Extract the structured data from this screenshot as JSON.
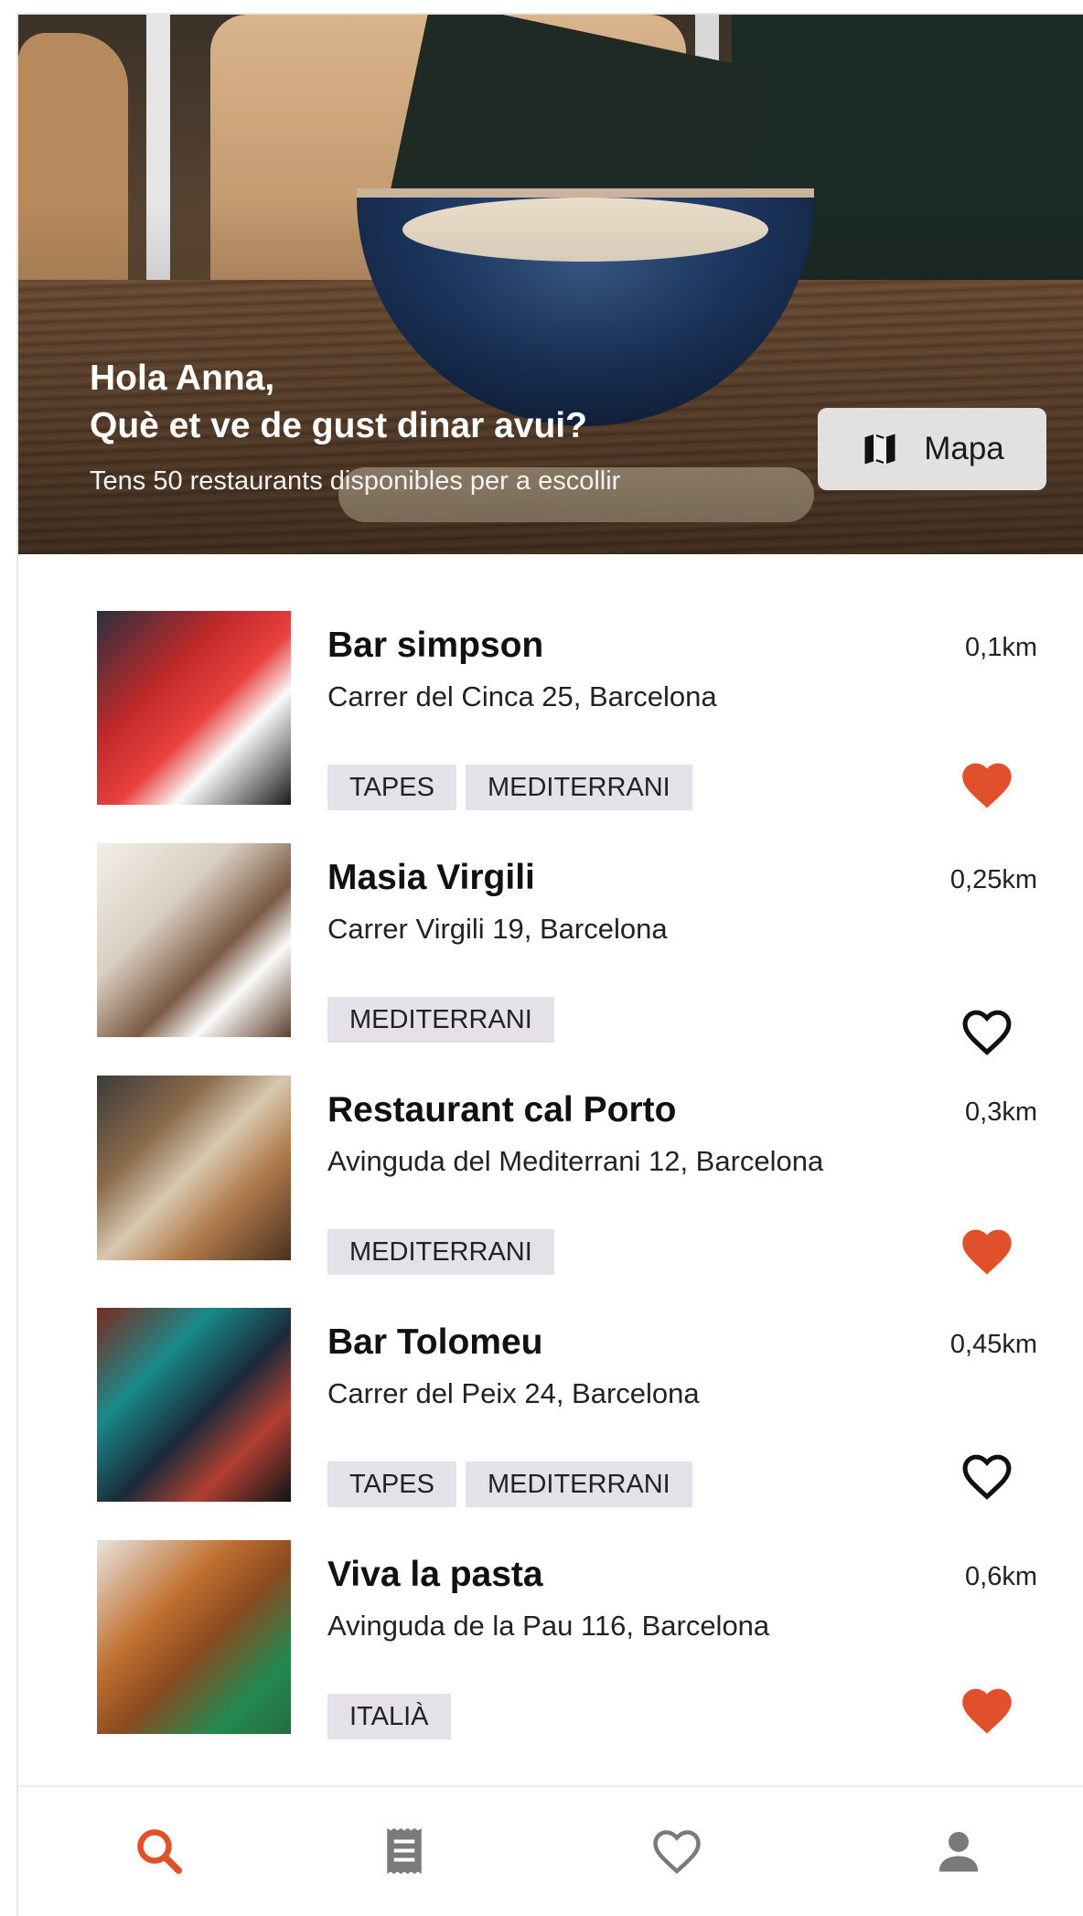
{
  "hero": {
    "greeting_line1": "Hola Anna,",
    "greeting_line2": "Què et ve de gust dinar avui?",
    "subtitle": "Tens 50 restaurants disponibles per a escollir",
    "map_button_label": "Mapa",
    "map_icon": "map-icon"
  },
  "colors": {
    "accent": "#e0502a",
    "tag_bg": "#e4e2e8",
    "nav_inactive": "#7a7a7a"
  },
  "restaurants": [
    {
      "name": "Bar simpson",
      "address": "Carrer del Cinca 25, Barcelona",
      "distance": "0,1km",
      "tags": [
        "TAPES",
        "MEDITERRANI"
      ],
      "favorite": true
    },
    {
      "name": "Masia Virgili",
      "address": "Carrer Virgili 19, Barcelona",
      "distance": "0,25km",
      "tags": [
        "MEDITERRANI"
      ],
      "favorite": false
    },
    {
      "name": "Restaurant cal Porto",
      "address": "Avinguda del Mediterrani 12, Barcelona",
      "distance": "0,3km",
      "tags": [
        "MEDITERRANI"
      ],
      "favorite": true
    },
    {
      "name": "Bar Tolomeu",
      "address": "Carrer del Peix 24, Barcelona",
      "distance": "0,45km",
      "tags": [
        "TAPES",
        "MEDITERRANI"
      ],
      "favorite": false
    },
    {
      "name": "Viva la pasta",
      "address": "Avinguda de la Pau 116, Barcelona",
      "distance": "0,6km",
      "tags": [
        "ITALIÀ"
      ],
      "favorite": true
    }
  ],
  "nav": {
    "items": [
      {
        "icon": "search-icon",
        "active": true
      },
      {
        "icon": "receipt-icon",
        "active": false
      },
      {
        "icon": "heart-outline-icon",
        "active": false
      },
      {
        "icon": "profile-icon",
        "active": false
      }
    ]
  }
}
